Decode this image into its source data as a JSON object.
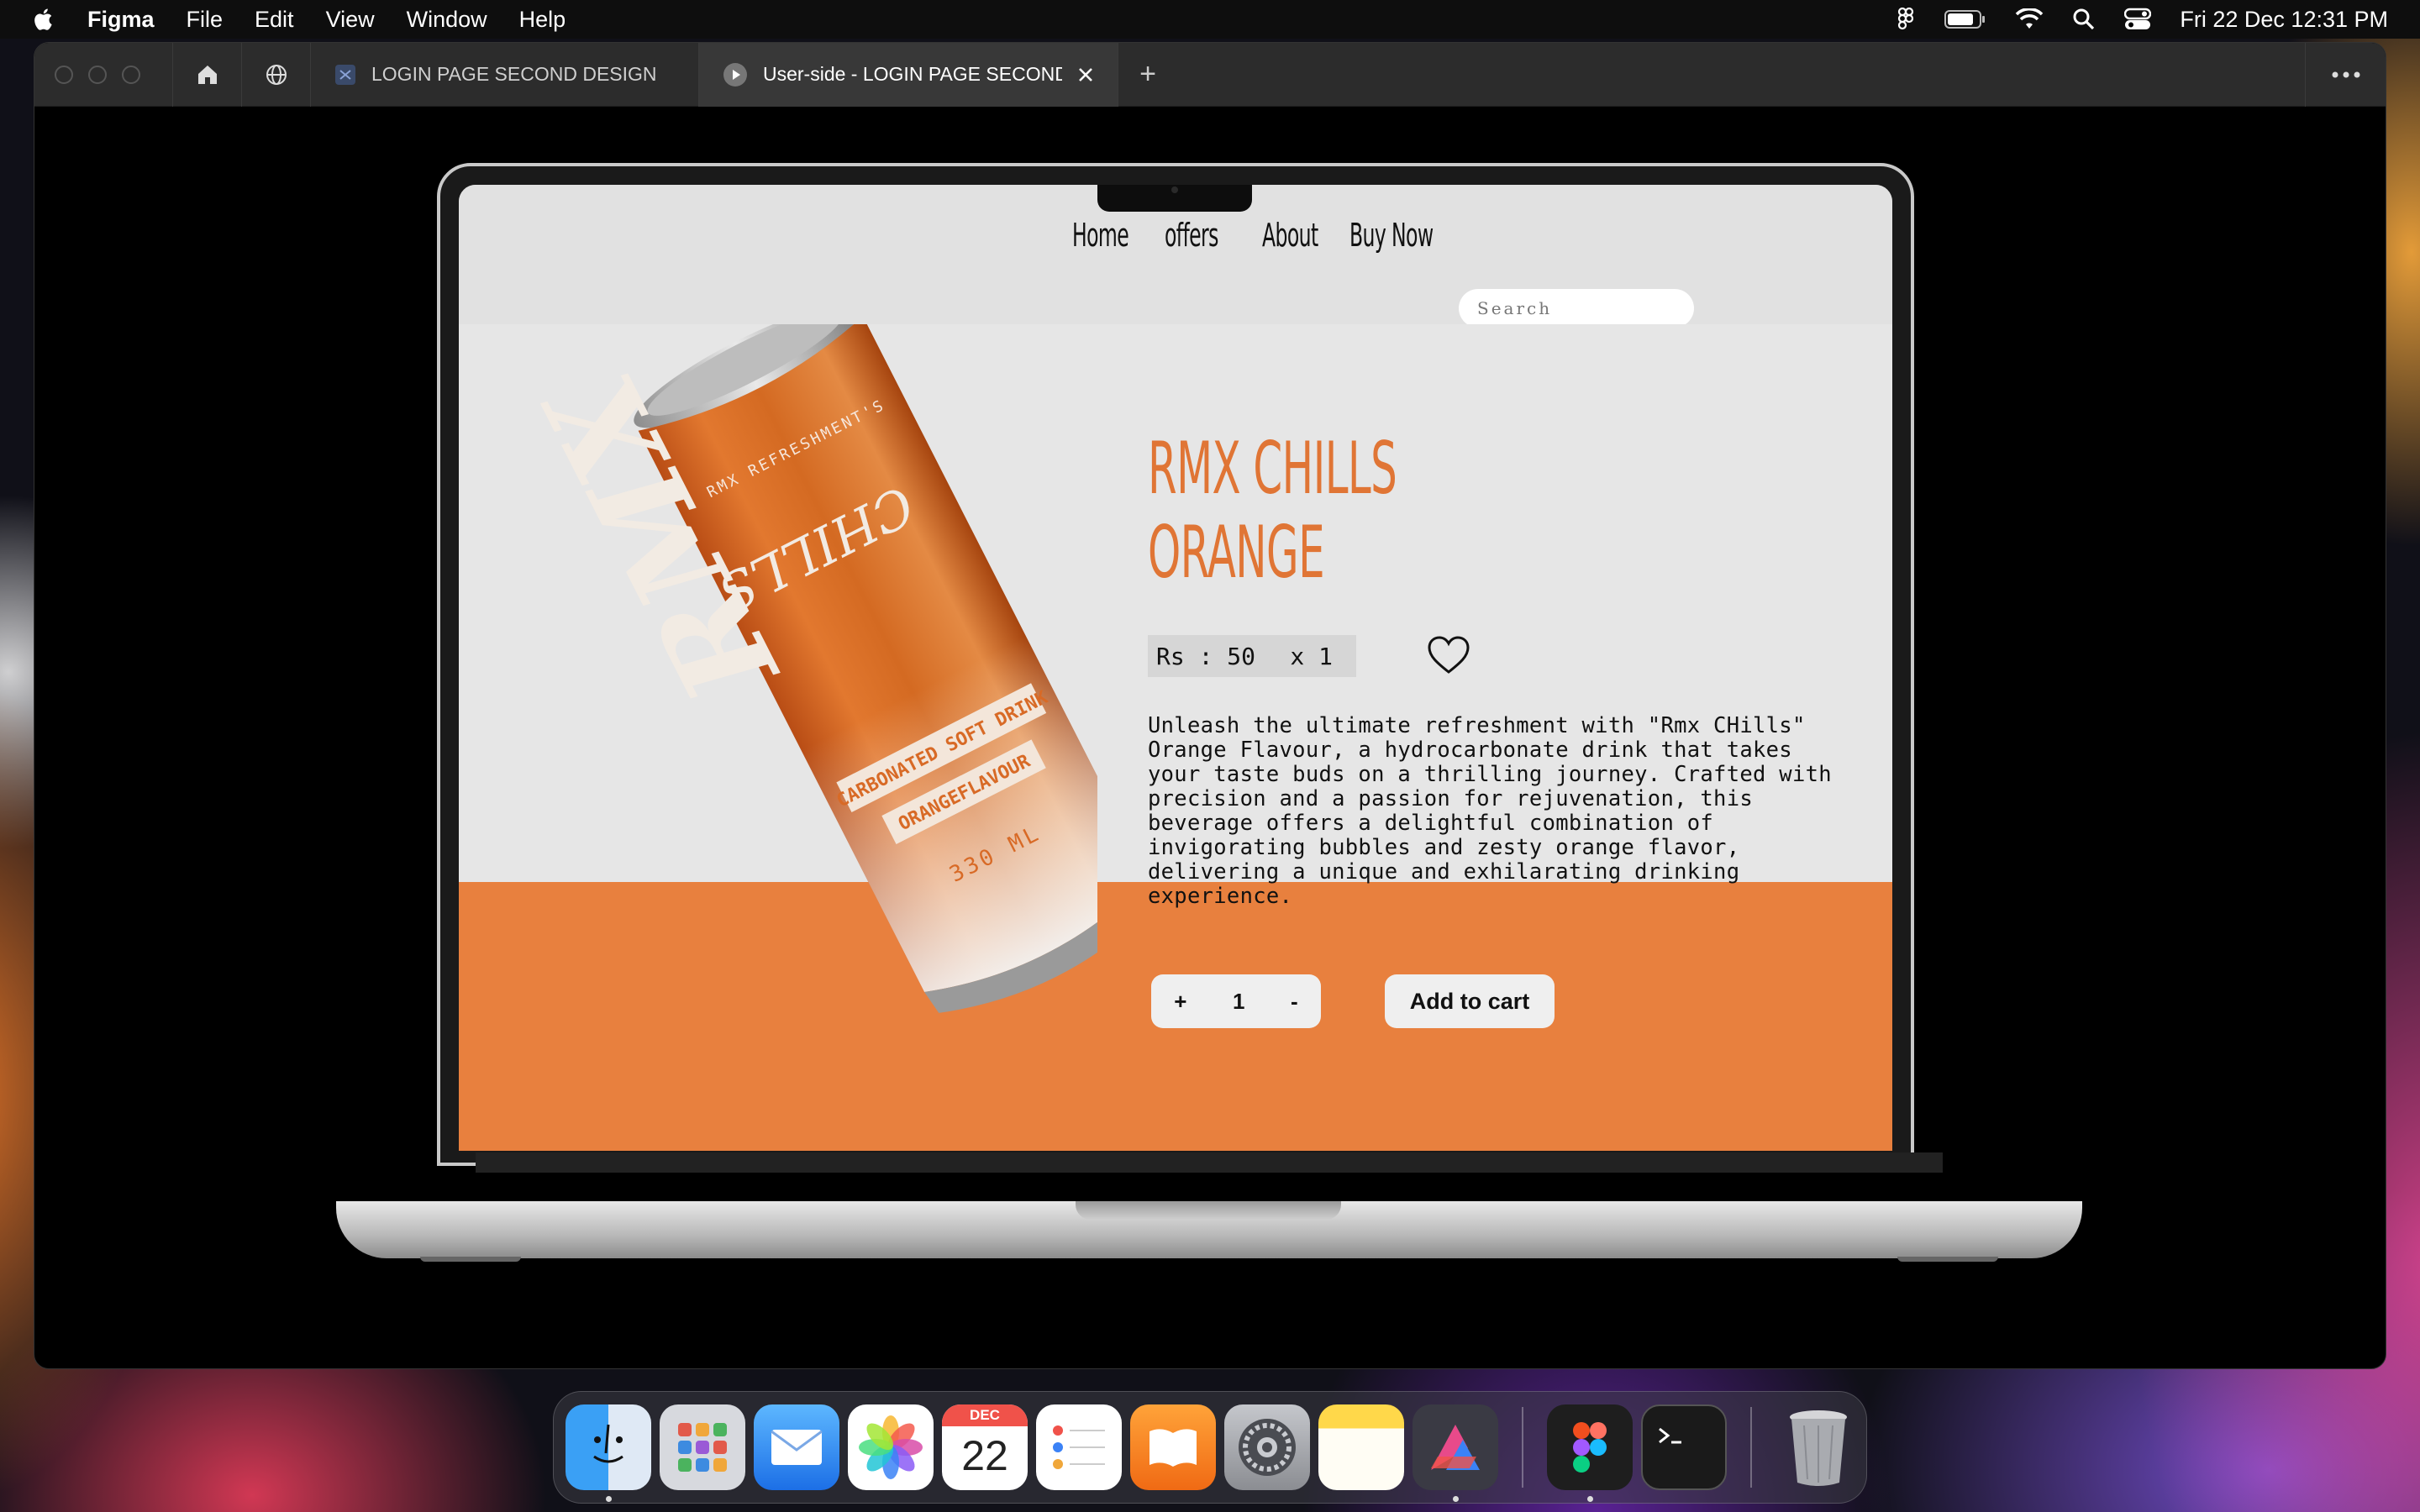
{
  "menubar": {
    "app_name": "Figma",
    "menus": [
      "File",
      "Edit",
      "View",
      "Window",
      "Help"
    ],
    "clock": "Fri 22 Dec  12:31 PM"
  },
  "window": {
    "tabs": [
      {
        "label": "LOGIN PAGE SECOND DESIGN",
        "icon": "figma-file-icon"
      },
      {
        "label": "User-side - LOGIN PAGE SECOND DESIGN",
        "icon": "play-icon",
        "active": true
      }
    ],
    "new_tab": "+"
  },
  "site": {
    "nav": [
      "Home",
      "offers",
      "About",
      "Buy Now"
    ],
    "search_placeholder": "Search",
    "product": {
      "title_line1": "RMX CHILLS",
      "title_line2": "ORANGE",
      "price": "Rs : 50",
      "qty_label": "x 1",
      "description": "Unleash the ultimate refreshment with \"Rmx CHills\" Orange Flavour, a hydrocarbonate drink that takes your taste buds on a thrilling journey. Crafted with precision and a passion for rejuvenation, this beverage offers a delightful combination of invigorating bubbles and zesty orange flavor, delivering a unique and exhilarating drinking experience."
    },
    "stepper": {
      "plus": "+",
      "value": "1",
      "minus": "-"
    },
    "add_to_cart": "Add to cart",
    "can": {
      "brand_small": "RMX REFRESHMENT'S",
      "logo": "RMX",
      "logo_sub": "CHILLS",
      "tag1": "CARBONATED SOFT DRINK",
      "tag2": "ORANGEFLAVOUR",
      "volume": "330 ML"
    }
  },
  "dock": {
    "calendar_month": "DEC",
    "calendar_day": "22",
    "apps": [
      "finder-icon",
      "launchpad-icon",
      "mail-icon",
      "photos-icon",
      "calendar-icon",
      "reminders-icon",
      "books-icon",
      "system-settings-icon",
      "notes-icon",
      "affinity-icon",
      "figma-icon",
      "terminal-icon",
      "trash-icon"
    ]
  },
  "colors": {
    "accent_orange": "#e8803e",
    "title_orange": "#e07535"
  }
}
